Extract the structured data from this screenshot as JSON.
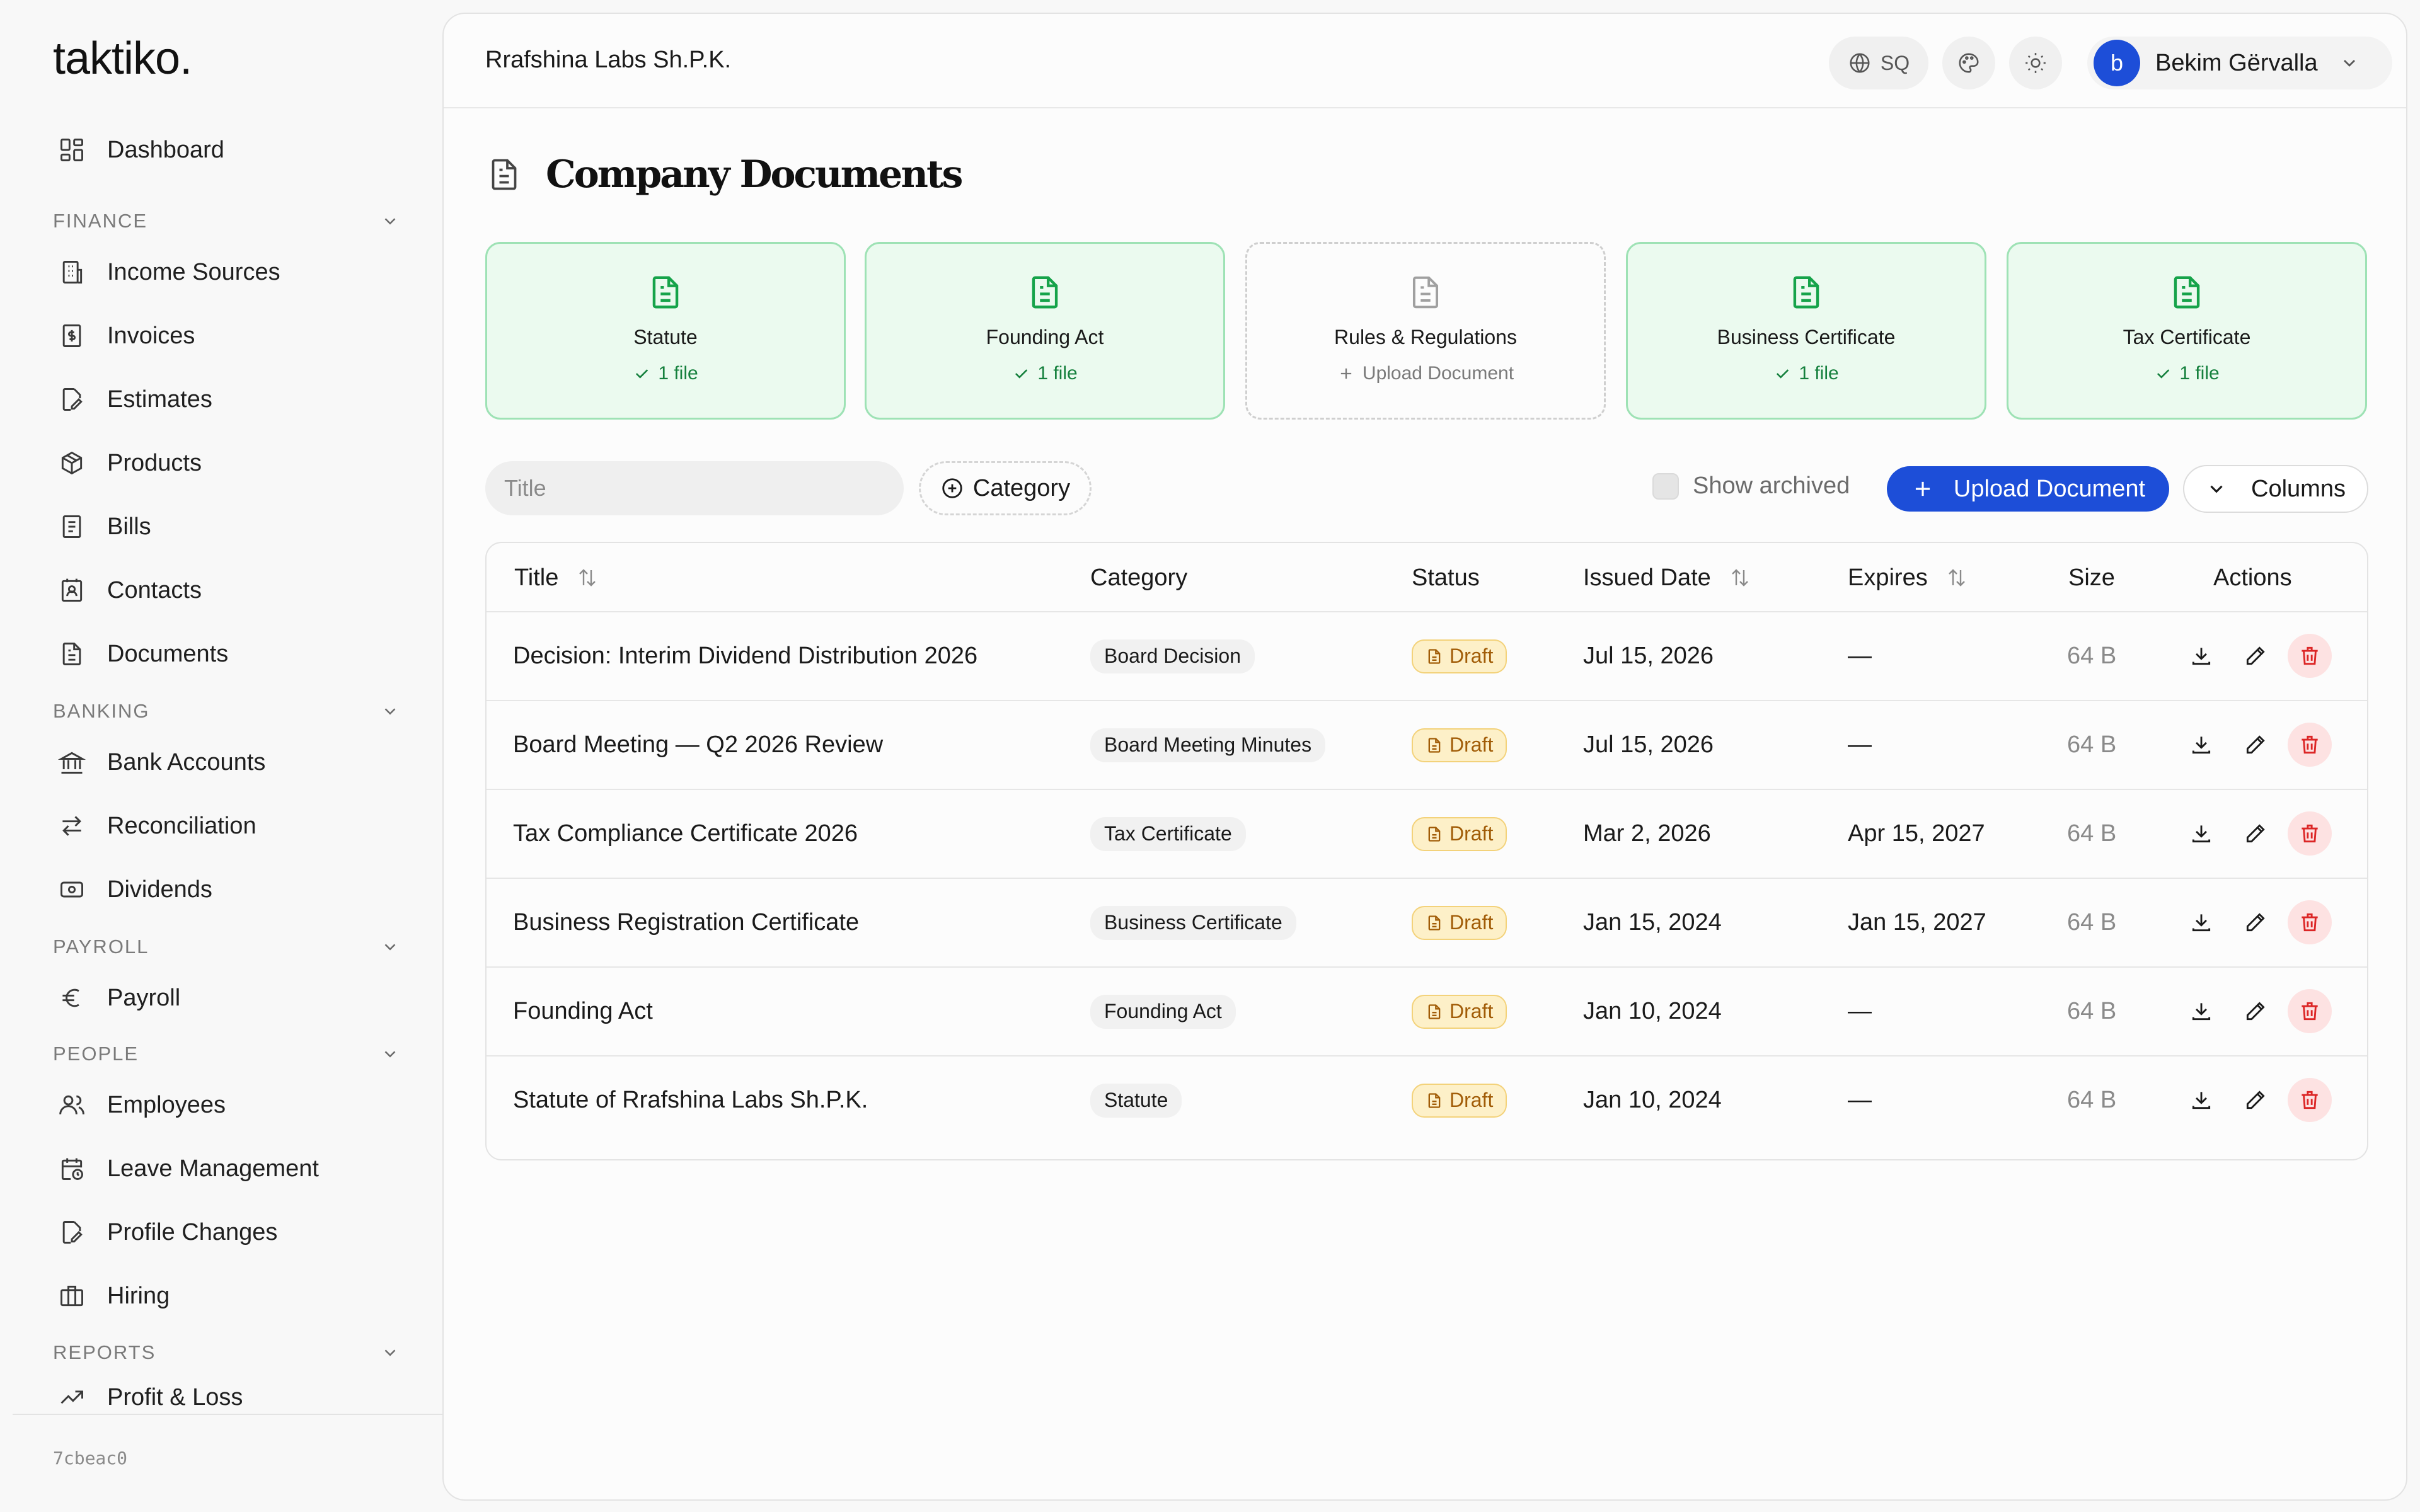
{
  "sidebar": {
    "logo": "taktiko.",
    "dashboard": "Dashboard",
    "sections": {
      "finance": "FINANCE",
      "banking": "BANKING",
      "payroll": "PAYROLL",
      "people": "PEOPLE",
      "reports": "REPORTS"
    },
    "finance_items": [
      "Income Sources",
      "Invoices",
      "Estimates",
      "Products",
      "Bills",
      "Contacts",
      "Documents"
    ],
    "banking_items": [
      "Bank Accounts",
      "Reconciliation",
      "Dividends"
    ],
    "payroll_items": [
      "Payroll"
    ],
    "people_items": [
      "Employees",
      "Leave Management",
      "Profile Changes",
      "Hiring"
    ],
    "reports_items": [
      "Profit & Loss"
    ],
    "build_hash": "7cbeac0"
  },
  "topbar": {
    "company": "Rrafshina Labs Sh.P.K.",
    "language": "SQ",
    "user_initial": "b",
    "user_name": "Bekim Gërvalla"
  },
  "page": {
    "title": "Company Documents"
  },
  "doc_cards": [
    {
      "title": "Statute",
      "sub": "1 file",
      "state": "done"
    },
    {
      "title": "Founding Act",
      "sub": "1 file",
      "state": "done"
    },
    {
      "title": "Rules & Regulations",
      "sub": "Upload Document",
      "state": "empty"
    },
    {
      "title": "Business Certificate",
      "sub": "1 file",
      "state": "done"
    },
    {
      "title": "Tax Certificate",
      "sub": "1 file",
      "state": "done"
    }
  ],
  "filters": {
    "title_placeholder": "Title",
    "category_label": "Category",
    "show_archived": "Show archived",
    "upload_label": "Upload Document",
    "columns_label": "Columns"
  },
  "table": {
    "headers": {
      "title": "Title",
      "category": "Category",
      "status": "Status",
      "issued": "Issued Date",
      "expires": "Expires",
      "size": "Size",
      "actions": "Actions"
    },
    "rows": [
      {
        "title": "Decision: Interim Dividend Distribution 2026",
        "category": "Board Decision",
        "status": "Draft",
        "issued": "Jul 15, 2026",
        "expires": "—",
        "size": "64 B"
      },
      {
        "title": "Board Meeting — Q2 2026 Review",
        "category": "Board Meeting Minutes",
        "status": "Draft",
        "issued": "Jul 15, 2026",
        "expires": "—",
        "size": "64 B"
      },
      {
        "title": "Tax Compliance Certificate 2026",
        "category": "Tax Certificate",
        "status": "Draft",
        "issued": "Mar 2, 2026",
        "expires": "Apr 15, 2027",
        "size": "64 B"
      },
      {
        "title": "Business Registration Certificate",
        "category": "Business Certificate",
        "status": "Draft",
        "issued": "Jan 15, 2024",
        "expires": "Jan 15, 2027",
        "size": "64 B"
      },
      {
        "title": "Founding Act",
        "category": "Founding Act",
        "status": "Draft",
        "issued": "Jan 10, 2024",
        "expires": "—",
        "size": "64 B"
      },
      {
        "title": "Statute of Rrafshina Labs Sh.P.K.",
        "category": "Statute",
        "status": "Draft",
        "issued": "Jan 10, 2024",
        "expires": "—",
        "size": "64 B"
      }
    ]
  },
  "colors": {
    "accent": "#1d4ed8",
    "success": "#16a34a",
    "draft": "#a15c07",
    "danger": "#dc2626"
  }
}
